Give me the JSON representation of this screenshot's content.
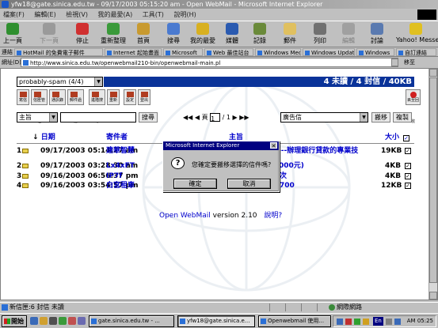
{
  "window": {
    "title": "yfw18@gate.sinica.edu.tw - 09/17/2003 05:15:20 am - Open WebMail - Microsoft Internet Explorer"
  },
  "menu": [
    "檔案(F)",
    "編輯(E)",
    "檢視(V)",
    "我的最愛(A)",
    "工具(T)",
    "說明(H)"
  ],
  "toolbar": [
    "上一頁",
    "下一頁",
    "停止",
    "重新整理",
    "首頁",
    "搜尋",
    "我的最愛",
    "媒體",
    "記錄",
    "郵件",
    "列印",
    "編輯",
    "討論",
    "Yahoo! Messenger"
  ],
  "links": {
    "label": "連結",
    "items": [
      "HotMail 的免費電子郵件",
      "Internet 起始畫面",
      "Microsoft",
      "Web 最佳站台",
      "Windows Media",
      "Windows Update",
      "Windows",
      "自訂連結"
    ]
  },
  "address": {
    "label": "網址(D)",
    "url": "http://www.sinica.edu.tw/openwebmail210-bin/openwebmail-main.pl",
    "go": "移至"
  },
  "mail": {
    "folder": "probably-spam (4/4)",
    "summary": "4 未讀 / 4 封信 / 40KB",
    "folder_icons": [
      "寫信",
      "信匣管理",
      "通訊錄",
      "郵件過濾",
      "進階搜尋",
      "重新",
      "設定",
      "登出"
    ],
    "save_icon": "丟至回收",
    "search_field": "主旨",
    "search_button": "搜尋",
    "page_label": "頁",
    "page_value": "1",
    "page_total": "/ 1",
    "move_target": "廣告信",
    "move_button": "搬移",
    "copy_button": "複製",
    "headers": {
      "date": "日期",
      "sender": "寄件者",
      "subject": "主旨",
      "size": "大小"
    },
    "rows": [
      {
        "num": "1",
        "date": "09/17/2003 05:14:27 am",
        "sender": "建華智慧",
        "subject": "說---辦理銀行貸款的專業技",
        "size": "19KB"
      },
      {
        "num": "2",
        "date": "09/17/2003 03:28:30 am",
        "sender": "Lx4xFT",
        "subject": "000元)",
        "size": "4KB"
      },
      {
        "num": "3",
        "date": "09/16/2003 06:56:37 pm",
        "sender": "IP7f",
        "subject": "次",
        "size": "4KB"
      },
      {
        "num": "4",
        "date": "09/16/2003 03:54:57 pm",
        "sender": "白宮租車",
        "subject": "700",
        "size": "12KB"
      }
    ],
    "footer_brand": "Open WebMail",
    "footer_version": " version 2.10",
    "footer_help": "說明?"
  },
  "dialog": {
    "title": "Microsoft Internet Explorer",
    "message": "您確定要搬移選擇的信件嗎?",
    "ok": "確定",
    "cancel": "取消"
  },
  "status": {
    "text": "新信匣:6 封信 未讀",
    "zone": "網際網路"
  },
  "taskbar": {
    "start": "開始",
    "tasks": [
      "gate.sinica.edu.tw - ...",
      "yfw18@gate.sinica.e...",
      "Openwebmail 使用..."
    ],
    "lang": "En",
    "clock": "AM 05:25"
  }
}
